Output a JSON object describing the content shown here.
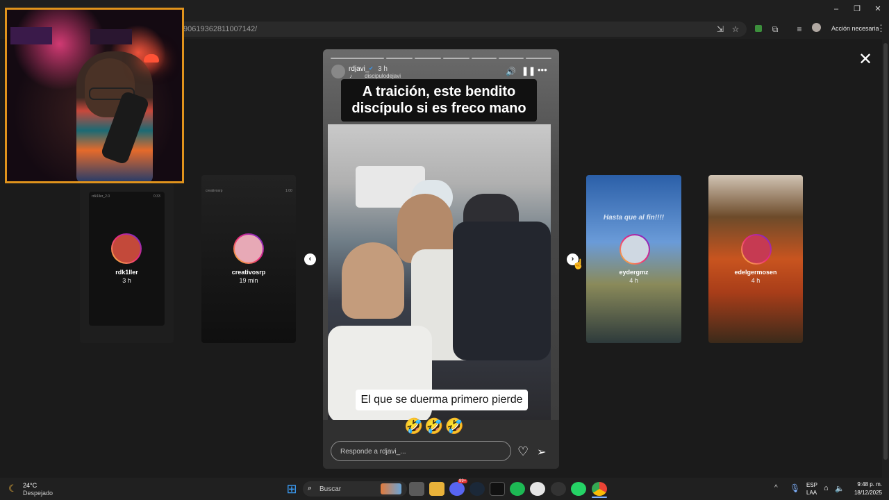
{
  "browser": {
    "url": "90619362811007142/",
    "action_label": "Acción necesaria",
    "window_buttons": [
      "–",
      "❐",
      "✕"
    ]
  },
  "webcam": {
    "label": "streamer-webcam"
  },
  "stories": {
    "left_cards": [
      {
        "user": "rdk1ller",
        "time": "3 h",
        "tiny_user": "rdk1ller_2.0",
        "tiny_time": "0:33"
      },
      {
        "user": "creativosrp",
        "time": "19 min",
        "tiny_user": "creativosrp",
        "tiny_time": "1:00"
      }
    ],
    "right_cards": [
      {
        "user": "eydergmz",
        "time": "4 h",
        "overlay_text": "Hasta que al fin!!!!"
      },
      {
        "user": "edelgermosen",
        "time": "4 h"
      }
    ],
    "current": {
      "user": "rdjavi_",
      "time": "3 h",
      "music": "discipulodejavi",
      "headline": "A traición, este bendito discípulo si es freco mano",
      "subtitle": "El que se duerma primero pierde",
      "emojis": "🤣🤣🤣",
      "reply_placeholder": "Responde a rdjavi_..."
    }
  },
  "taskbar": {
    "weather_temp": "24°C",
    "weather_desc": "Despejado",
    "search_placeholder": "Buscar",
    "lang_top": "ESP",
    "lang_bottom": "LAA",
    "time": "9:48 p. m.",
    "date": "18/12/2025",
    "badge": "99+"
  }
}
